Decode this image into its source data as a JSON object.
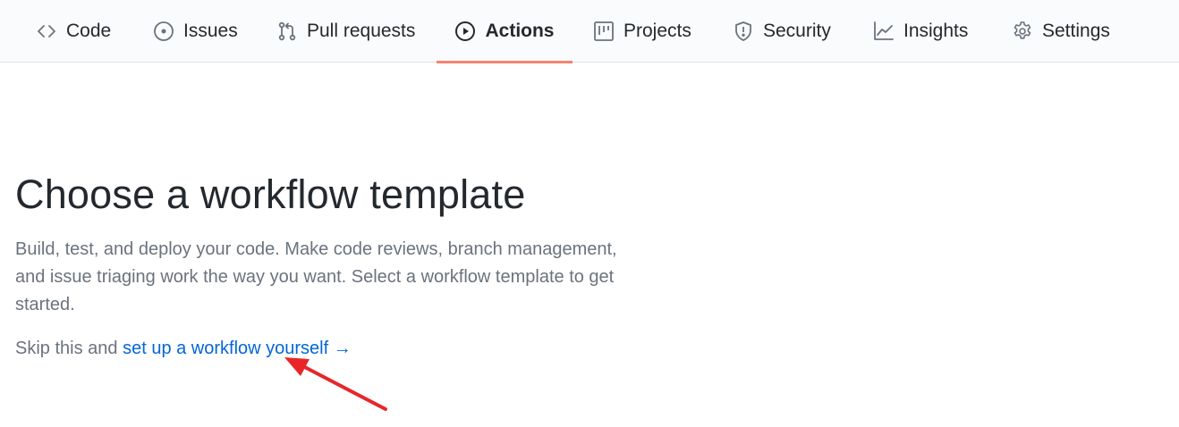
{
  "tabs": [
    {
      "label": "Code",
      "icon": "code-icon",
      "selected": false
    },
    {
      "label": "Issues",
      "icon": "issue-icon",
      "selected": false
    },
    {
      "label": "Pull requests",
      "icon": "pull-request-icon",
      "selected": false
    },
    {
      "label": "Actions",
      "icon": "play-icon",
      "selected": true
    },
    {
      "label": "Projects",
      "icon": "project-icon",
      "selected": false
    },
    {
      "label": "Security",
      "icon": "shield-icon",
      "selected": false
    },
    {
      "label": "Insights",
      "icon": "graph-icon",
      "selected": false
    },
    {
      "label": "Settings",
      "icon": "gear-icon",
      "selected": false
    }
  ],
  "page": {
    "title": "Choose a workflow template",
    "description": "Build, test, and deploy your code. Make code reviews, branch management, and issue triaging work the way you want. Select a workflow template to get started.",
    "skip_prefix": "Skip this and ",
    "skip_link": "set up a workflow yourself",
    "skip_arrow": "→"
  },
  "colors": {
    "accent_underline": "#f9826c",
    "link": "#0366d6",
    "annotation_arrow": "#e8262a"
  }
}
